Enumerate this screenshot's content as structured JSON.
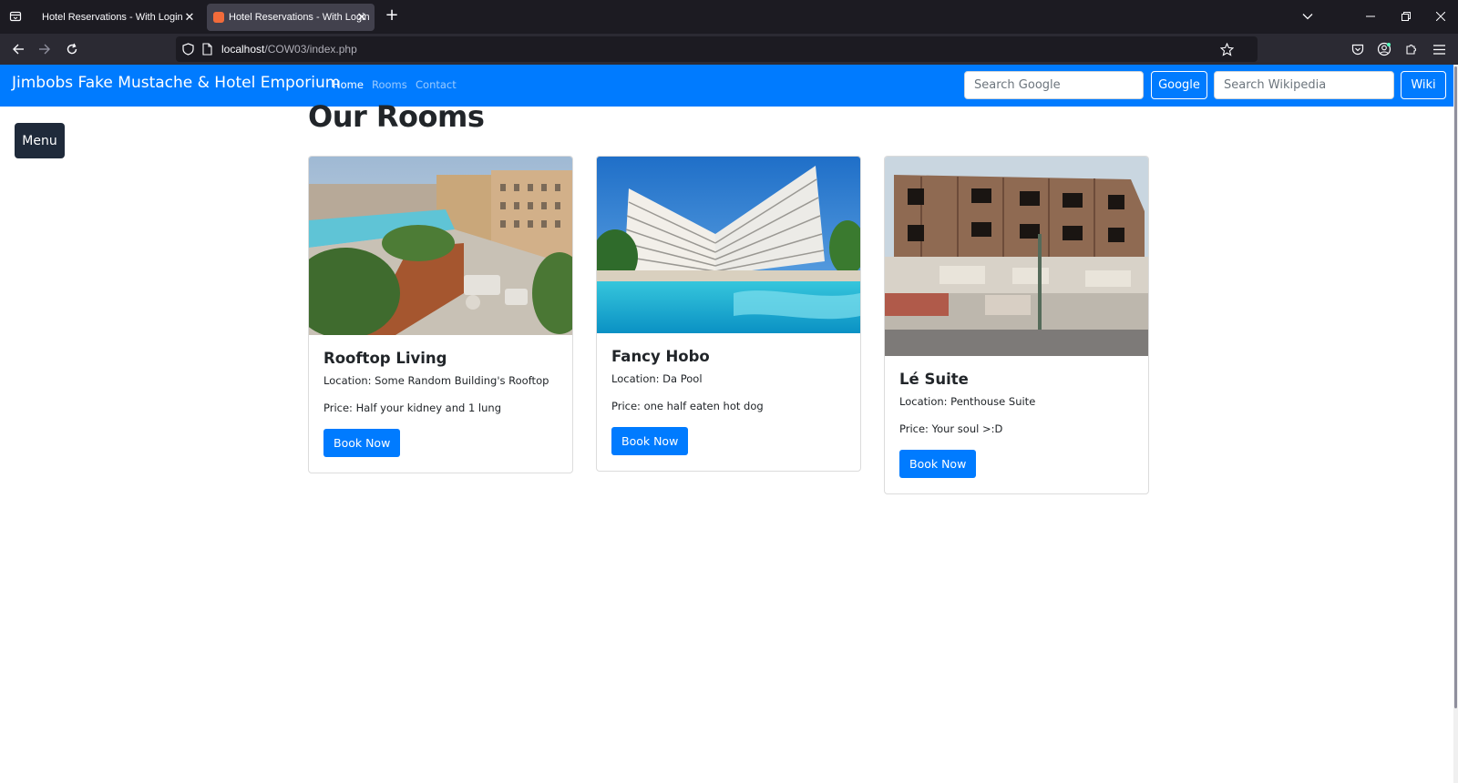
{
  "browser": {
    "tabs": [
      {
        "title": "Hotel Reservations - With Login",
        "active": false
      },
      {
        "title": "Hotel Reservations - With Login",
        "active": true
      }
    ],
    "url_host": "localhost",
    "url_path": "/COW03/index.php",
    "icons": {
      "tab_list": "tab-list-icon",
      "new_tab": "plus-icon",
      "back": "back-arrow-icon",
      "forward": "forward-arrow-icon",
      "reload": "reload-icon",
      "site_info": "shield-icon",
      "page": "page-icon",
      "bookmark": "star-icon",
      "pocket": "pocket-icon",
      "account": "account-icon",
      "extensions": "puzzle-icon",
      "menu": "hamburger-icon"
    }
  },
  "site": {
    "brand": "Jimbobs Fake Mustache & Hotel Emporium",
    "nav": {
      "home": "Home",
      "rooms": "Rooms",
      "contact": "Contact"
    },
    "search_google": {
      "placeholder": "Search Google",
      "button": "Google"
    },
    "search_wiki": {
      "placeholder": "Search Wikipedia",
      "button": "Wiki"
    },
    "menu_button": "Menu",
    "colors": {
      "primary": "#007bff",
      "menu_bg": "#1f2a3a"
    }
  },
  "main": {
    "title": "Our Rooms",
    "rooms": [
      {
        "name": "Rooftop Living",
        "location": "Location: Some Random Building's Rooftop",
        "price": "Price: Half your kidney and 1 lung",
        "button": "Book Now"
      },
      {
        "name": "Fancy Hobo",
        "location": "Location: Da Pool",
        "price": "Price: one half eaten hot dog",
        "button": "Book Now"
      },
      {
        "name": "Lé Suite",
        "location": "Location: Penthouse Suite",
        "price": "Price: Your soul >:D",
        "button": "Book Now"
      }
    ]
  }
}
